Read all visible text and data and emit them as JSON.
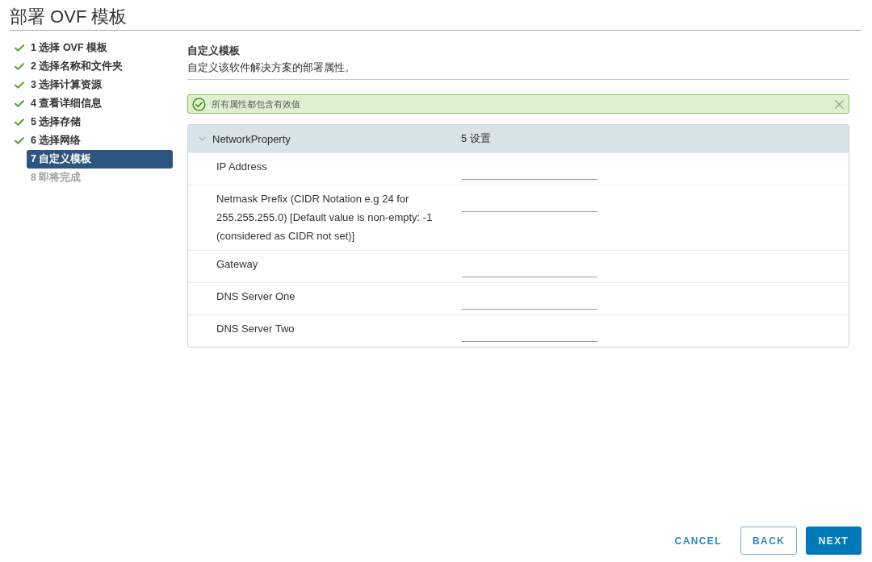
{
  "title": "部署 OVF 模板",
  "steps": [
    {
      "label": "1 选择 OVF 模板",
      "done": true,
      "selected": false,
      "disabled": false
    },
    {
      "label": "2 选择名称和文件夹",
      "done": true,
      "selected": false,
      "disabled": false
    },
    {
      "label": "3 选择计算资源",
      "done": true,
      "selected": false,
      "disabled": false
    },
    {
      "label": "4 查看详细信息",
      "done": true,
      "selected": false,
      "disabled": false
    },
    {
      "label": "5 选择存储",
      "done": true,
      "selected": false,
      "disabled": false
    },
    {
      "label": "6 选择网络",
      "done": true,
      "selected": false,
      "disabled": false
    },
    {
      "label": "7 自定义模板",
      "done": false,
      "selected": true,
      "disabled": false
    },
    {
      "label": "8 即将完成",
      "done": false,
      "selected": false,
      "disabled": true
    }
  ],
  "page": {
    "title": "自定义模板",
    "description": "自定义该软件解决方案的部署属性。"
  },
  "alert": {
    "kind": "success",
    "message": "所有属性都包含有效值"
  },
  "group": {
    "name": "NetworkProperty",
    "summary": "5 设置",
    "expanded": true,
    "properties": [
      {
        "label": "IP Address"
      },
      {
        "label": "Netmask Prefix (CIDR Notation e.g 24 for 255.255.255.0) [Default value is non-empty: -1 (considered as CIDR not set)]"
      },
      {
        "label": "Gateway"
      },
      {
        "label": "DNS Server One"
      },
      {
        "label": "DNS Server Two"
      }
    ]
  },
  "buttons": [
    {
      "label": "CANCEL",
      "kind": "flat"
    },
    {
      "label": "BACK",
      "kind": "outline"
    },
    {
      "label": "NEXT",
      "kind": "primary"
    }
  ]
}
